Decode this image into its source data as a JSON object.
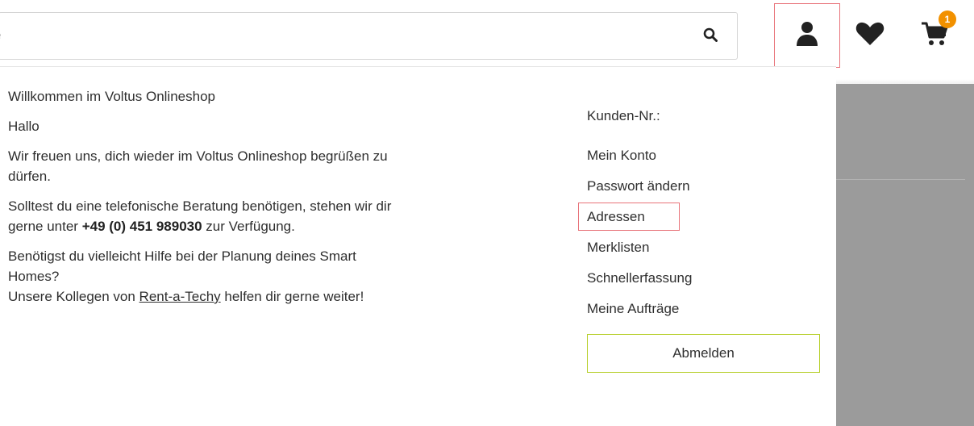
{
  "search": {
    "placeholder": "e"
  },
  "header": {
    "cart_count": "1"
  },
  "welcome": {
    "title": "Willkommen im Voltus Onlineshop",
    "greeting": "Hallo",
    "line1": "Wir freuen uns, dich wieder im Voltus Onlineshop begrüßen zu dürfen.",
    "line2_pre": "Solltest du eine telefonische Beratung benötigen, stehen wir dir gerne unter ",
    "phone": "+49 (0) 451 989030",
    "line2_post": " zur Verfügung.",
    "line3": "Benötigst du vielleicht Hilfe bei der Planung deines Smart Homes?",
    "line4_pre": "Unsere Kollegen von ",
    "line4_link": "Rent-a-Techy",
    "line4_post": " helfen dir gerne weiter!"
  },
  "account_menu": {
    "customer_no": "Kunden-Nr.:",
    "items": [
      "Mein Konto",
      "Passwort ändern",
      "Adressen",
      "Merklisten",
      "Schnellerfassung",
      "Meine Aufträge"
    ],
    "logout": "Abmelden"
  },
  "colors": {
    "highlight": "#e8737a",
    "badge": "#f29100",
    "logout_border": "#b6cf2a"
  },
  "icons": [
    "search-icon",
    "user-icon",
    "heart-icon",
    "cart-icon"
  ]
}
